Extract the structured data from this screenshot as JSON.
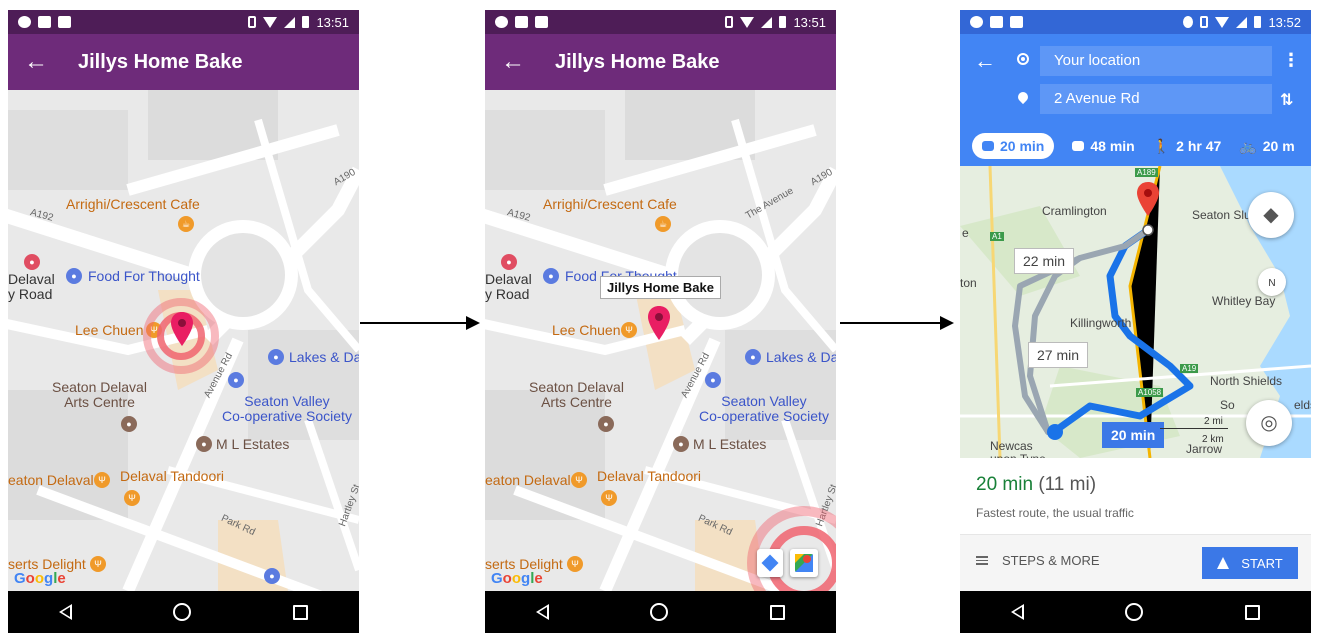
{
  "colors": {
    "app_bar": "#6e2b7a",
    "gmaps_blue": "#4285f4",
    "duration_green": "#188038",
    "marker_pink": "#e91e63",
    "tap_red": "#f06470"
  },
  "status_bar": {
    "time_1": "13:51",
    "time_2": "13:51",
    "time_3": "13:52"
  },
  "app": {
    "title": "Jillys Home Bake",
    "back_icon": "arrow-left-icon"
  },
  "map_labels": {
    "arrighi": "Arrighi/Crescent Cafe",
    "food_for_thought": "Food For Thought",
    "lee_chuen": "Lee Chuen",
    "lakes": "Lakes & Dal",
    "seaton_delaval_arts": "Seaton Delaval\nArts Centre",
    "seaton_valley": "Seaton Valley\nCo-operative Society",
    "ml_estates": "M L Estates",
    "delaval_tandoori": "Delaval Tandoori",
    "eaton_delaval": "eaton Delaval",
    "serts_delight": "serts Delight",
    "delaval_road": "Delaval\ny Road",
    "road_a192": "A192",
    "road_a190": "A190",
    "road_avenue": "Avenue Rd",
    "road_park": "Park Rd",
    "road_hartley": "Hartley St",
    "road_the_avenue": "The Avenue",
    "google_logo": [
      "G",
      "o",
      "o",
      "g",
      "l",
      "e"
    ]
  },
  "tooltip": {
    "text": "Jillys Home Bake"
  },
  "directions": {
    "origin": "Your location",
    "destination": "2 Avenue Rd",
    "modes": [
      {
        "label": "20 min",
        "icon": "car-icon",
        "active": true
      },
      {
        "label": "48 min",
        "icon": "train-icon",
        "active": false
      },
      {
        "label": "2 hr 47",
        "icon": "walk-icon",
        "active": false
      },
      {
        "label": "20 m",
        "icon": "bike-icon",
        "active": false
      }
    ],
    "map": {
      "labels": {
        "cramlington": "Cramlington",
        "seaton_sluice": "Seaton Sluice",
        "whitley_bay": "Whitley Bay",
        "killingworth": "Killingworth",
        "north_shields": "North Shields",
        "newcastle": "Newcas\nupon Tyne",
        "jarrow": "Jarrow",
        "so": "So",
        "elds": "elds",
        "ton": "ton",
        "e": "e"
      },
      "route_times": {
        "alt_1": "22 min",
        "alt_2": "27 min",
        "selected": "20 min"
      },
      "scale_mi": "2 mi",
      "scale_km": "2 km",
      "compass_n": "N",
      "roads": [
        "A19",
        "A1058",
        "A189",
        "A1"
      ]
    },
    "summary": {
      "duration": "20 min",
      "distance": "(11 mi)",
      "note": "Fastest route, the usual traffic"
    },
    "actions": {
      "steps": "STEPS & MORE",
      "start": "START"
    }
  }
}
